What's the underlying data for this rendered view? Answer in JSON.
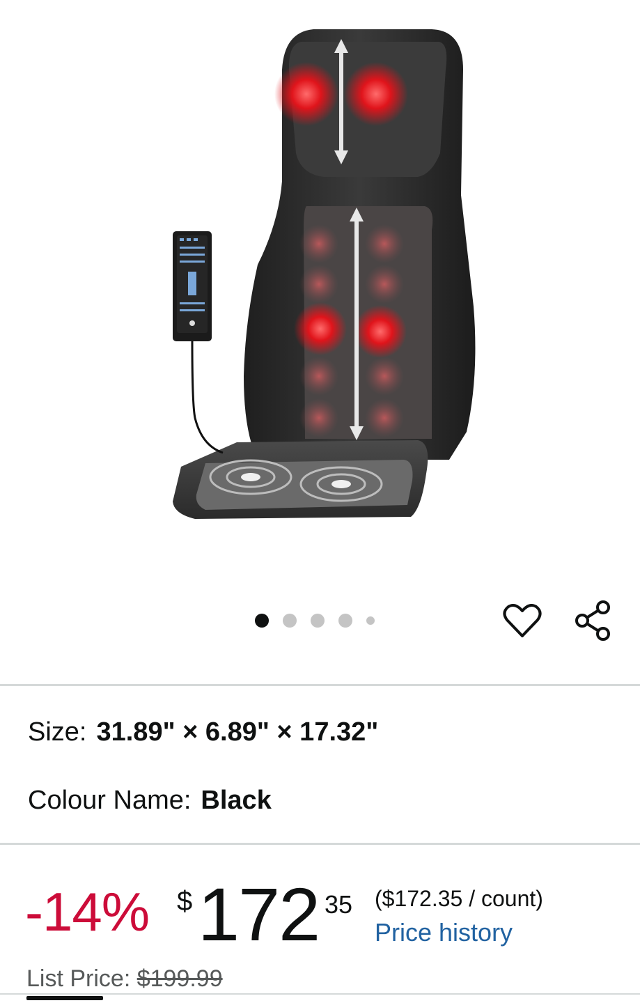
{
  "product": {
    "image_alt_icon": "massage-seat-cushion-image",
    "carousel": {
      "total_dots": 5,
      "active_index": 0
    }
  },
  "actions": {
    "wishlist_icon": "heart-icon",
    "share_icon": "share-icon"
  },
  "attributes": {
    "size_label": "Size:",
    "size_value": "31.89\" × 6.89\" × 17.32\"",
    "colour_label": "Colour Name:",
    "colour_value": "Black"
  },
  "pricing": {
    "discount": "-14%",
    "currency_symbol": "$",
    "price_whole": "172",
    "price_fraction": "35",
    "unit_price": "($172.35 / count)",
    "price_history_link": "Price history",
    "list_price_label": "List Price:",
    "list_price_value": "$199.99"
  },
  "colors": {
    "discount_red": "#cc0c39",
    "link_blue": "#2162a1",
    "divider": "#d5d9d9"
  }
}
